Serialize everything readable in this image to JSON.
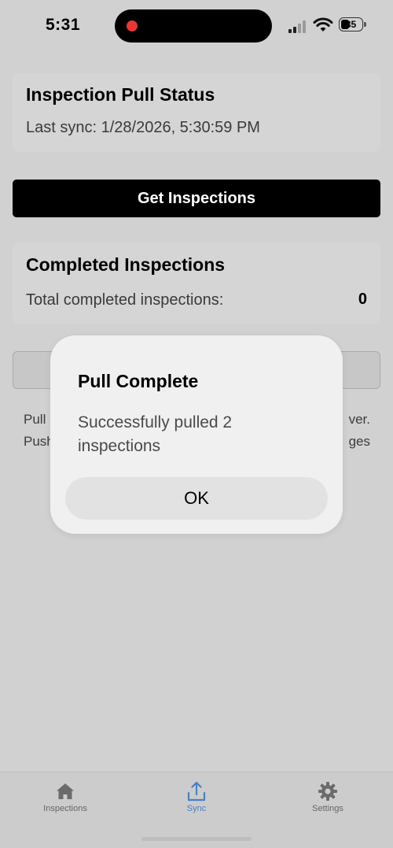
{
  "status_bar": {
    "time": "5:31",
    "battery": "35"
  },
  "pull_status": {
    "title": "Inspection Pull Status",
    "last_sync": "Last sync: 1/28/2026, 5:30:59 PM"
  },
  "get_button_label": "Get Inspections",
  "completed": {
    "title": "Completed Inspections",
    "label": "Total completed inspections:",
    "count": "0"
  },
  "help_text": {
    "line1_start": "Pull",
    "line1_end": "ver.",
    "line2_start": "Push",
    "line2_end": "ges"
  },
  "alert": {
    "title": "Pull Complete",
    "message": "Successfully pulled 2 inspections",
    "ok_label": "OK"
  },
  "tabs": [
    {
      "label": "Inspections",
      "icon": "home-icon"
    },
    {
      "label": "Sync",
      "icon": "upload-icon",
      "active": true
    },
    {
      "label": "Settings",
      "icon": "gear-icon"
    }
  ],
  "colors": {
    "accent": "#4a80c4",
    "primary_button": "#000000",
    "recording_dot": "#e8382f"
  }
}
